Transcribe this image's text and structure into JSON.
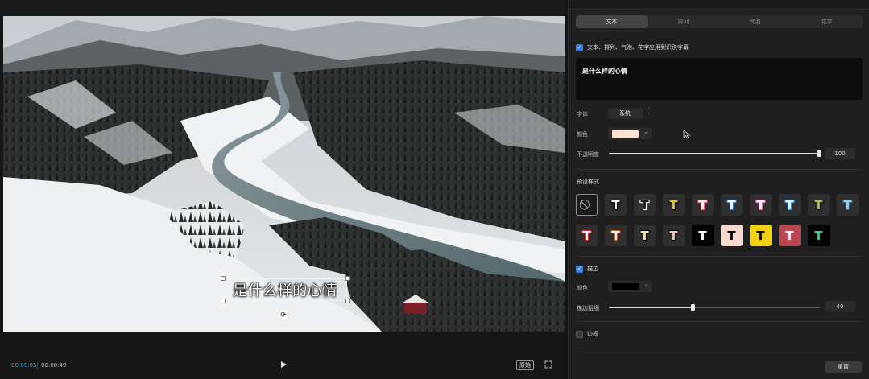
{
  "player": {
    "caption": "是什么样的心情",
    "time_current": "00:00:05",
    "time_separator": "|",
    "time_total": "00:08:49",
    "ratio_label": "原始",
    "icons": {
      "play": "play-icon",
      "fullscreen": "fullscreen-icon",
      "rotate": "rotate-icon"
    }
  },
  "inspector": {
    "tabs": [
      {
        "label": "文本",
        "active": true
      },
      {
        "label": "排列",
        "active": false
      },
      {
        "label": "气泡",
        "active": false
      },
      {
        "label": "花字",
        "active": false
      }
    ],
    "apply_all": {
      "label": "文本、排列、气泡、花字应用到识别字幕",
      "checked": true
    },
    "text_value": "是什么样的心情",
    "font": {
      "label": "字体",
      "value": "系统"
    },
    "color": {
      "label": "颜色",
      "value": "#fde1d6"
    },
    "opacity": {
      "label": "不透明度",
      "value": "100",
      "fraction": 1.0
    },
    "preset_title": "预设样式",
    "presets": [
      {
        "glyph": "⃠",
        "type": "none",
        "bg": "#1a1a1a",
        "fg": "#dddddd",
        "stroke": ""
      },
      {
        "glyph": "T",
        "bg": "#2f2f2f",
        "fg": "#ffffff",
        "stroke": "#000000"
      },
      {
        "glyph": "T",
        "bg": "#2f2f2f",
        "fg": "#1a1a1a",
        "stroke": "#ffffff"
      },
      {
        "glyph": "T",
        "bg": "#2f2f2f",
        "fg": "#f1c21b",
        "stroke": "#000000"
      },
      {
        "glyph": "T",
        "bg": "#2f2f2f",
        "fg": "#ffffff",
        "stroke": "#e2646b"
      },
      {
        "glyph": "T",
        "bg": "#2f2f2f",
        "fg": "#ffffff",
        "stroke": "#3b6fb8"
      },
      {
        "glyph": "T",
        "bg": "#2f2f2f",
        "fg": "#ffffff",
        "stroke": "#e062a5"
      },
      {
        "glyph": "T",
        "bg": "#2f2f2f",
        "fg": "#ffffff",
        "stroke": "#1e90e6"
      },
      {
        "glyph": "T",
        "bg": "#2f2f2f",
        "fg": "#b9c23a",
        "stroke": "#000000"
      },
      {
        "glyph": "T",
        "bg": "#2f2f2f",
        "fg": "#8fd0ef",
        "stroke": "#3a5f7a"
      },
      {
        "glyph": "T",
        "bg": "#2f2f2f",
        "fg": "#ffffff",
        "stroke": "#d0262f"
      },
      {
        "glyph": "T",
        "bg": "#2f2f2f",
        "fg": "#ffffff",
        "stroke": "#b8562a"
      },
      {
        "glyph": "T",
        "bg": "#2f2f2f",
        "fg": "#f5e6a5",
        "stroke": "#000000"
      },
      {
        "glyph": "T",
        "bg": "#2f2f2f",
        "fg": "#f6c8be",
        "stroke": "#000000"
      },
      {
        "glyph": "T",
        "bg": "#000000",
        "fg": "#ffffff",
        "stroke": ""
      },
      {
        "glyph": "T",
        "bg": "#f7d9cf",
        "fg": "#000000",
        "stroke": ""
      },
      {
        "glyph": "T",
        "bg": "#f3d113",
        "fg": "#000000",
        "stroke": ""
      },
      {
        "glyph": "T",
        "bg": "#b8474f",
        "fg": "#ffffff",
        "stroke": ""
      },
      {
        "glyph": "T",
        "bg": "#000000",
        "fg": "#3ad18a",
        "stroke": ""
      }
    ],
    "stroke": {
      "label": "描边",
      "checked": true
    },
    "stroke_color": {
      "label": "颜色",
      "value": "#000000"
    },
    "stroke_width": {
      "label": "描边粗细",
      "value": "40",
      "fraction": 0.4
    },
    "border": {
      "label": "边框",
      "checked": false
    },
    "reset_label": "重置"
  }
}
